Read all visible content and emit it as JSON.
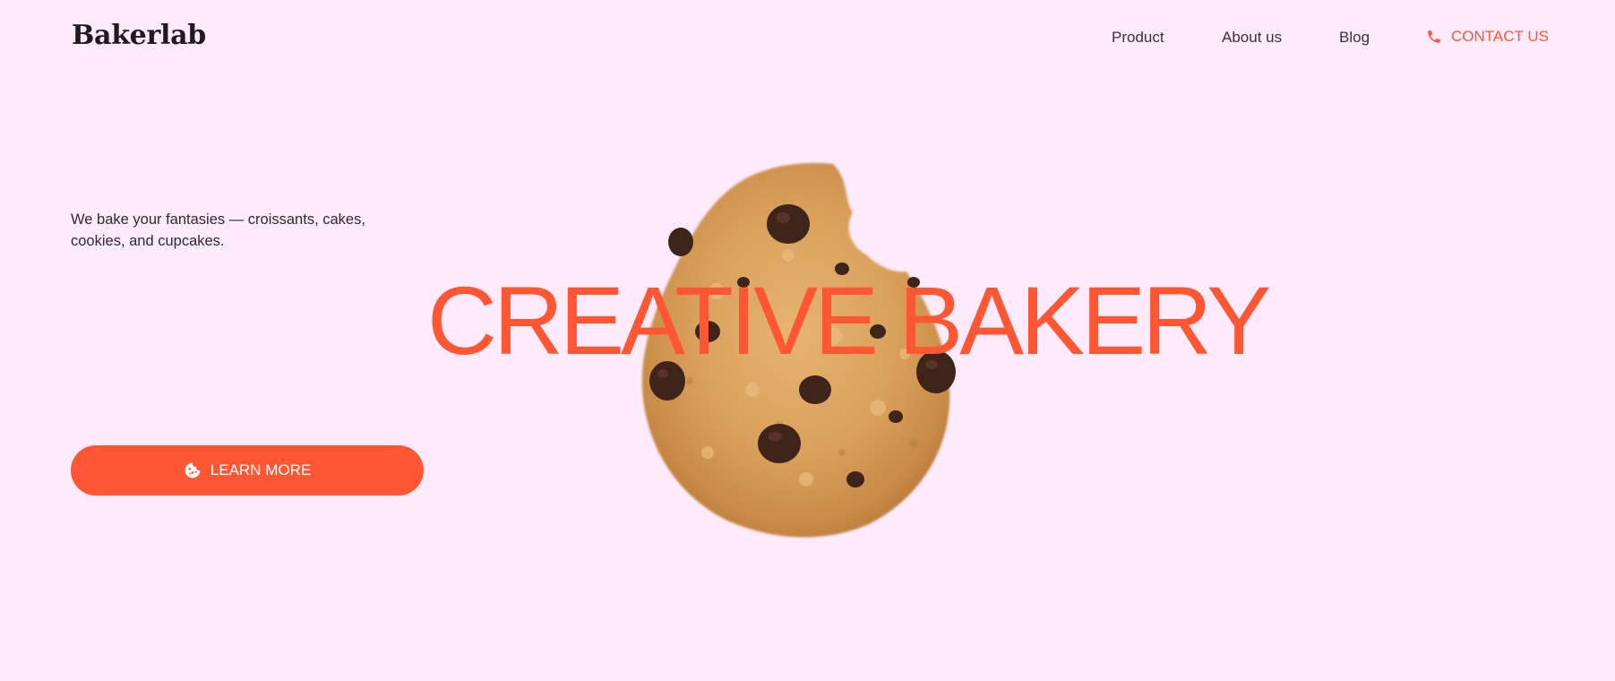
{
  "brand": {
    "logo_text": "Bakerlab"
  },
  "nav": {
    "items": [
      {
        "label": "Product"
      },
      {
        "label": "About us"
      },
      {
        "label": "Blog"
      }
    ],
    "contact_label": "CONTACT US",
    "contact_icon": "phone-icon"
  },
  "hero": {
    "intro_text": "We bake your fantasies — croissants, cakes, cookies, and cupcakes.",
    "headline": "CREATIVE BAKERY",
    "image": "chocolate-chip-cookie",
    "button_label": "LEARN MORE",
    "button_icon": "cookie-icon"
  },
  "colors": {
    "background": "#fdebfb",
    "accent": "#ff5733",
    "text": "#2a2228"
  }
}
